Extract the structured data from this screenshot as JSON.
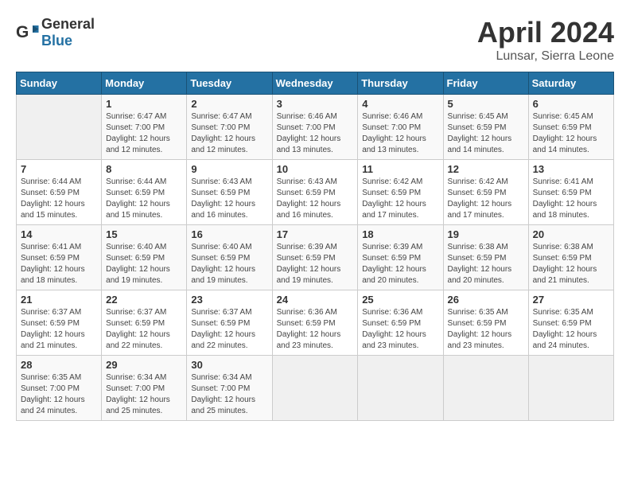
{
  "header": {
    "logo_general": "General",
    "logo_blue": "Blue",
    "month_title": "April 2024",
    "location": "Lunsar, Sierra Leone"
  },
  "days_of_week": [
    "Sunday",
    "Monday",
    "Tuesday",
    "Wednesday",
    "Thursday",
    "Friday",
    "Saturday"
  ],
  "weeks": [
    [
      {
        "day": "",
        "sunrise": "",
        "sunset": "",
        "daylight": ""
      },
      {
        "day": "1",
        "sunrise": "6:47 AM",
        "sunset": "7:00 PM",
        "daylight": "12 hours and 12 minutes."
      },
      {
        "day": "2",
        "sunrise": "6:47 AM",
        "sunset": "7:00 PM",
        "daylight": "12 hours and 12 minutes."
      },
      {
        "day": "3",
        "sunrise": "6:46 AM",
        "sunset": "7:00 PM",
        "daylight": "12 hours and 13 minutes."
      },
      {
        "day": "4",
        "sunrise": "6:46 AM",
        "sunset": "7:00 PM",
        "daylight": "12 hours and 13 minutes."
      },
      {
        "day": "5",
        "sunrise": "6:45 AM",
        "sunset": "6:59 PM",
        "daylight": "12 hours and 14 minutes."
      },
      {
        "day": "6",
        "sunrise": "6:45 AM",
        "sunset": "6:59 PM",
        "daylight": "12 hours and 14 minutes."
      }
    ],
    [
      {
        "day": "7",
        "sunrise": "6:44 AM",
        "sunset": "6:59 PM",
        "daylight": "12 hours and 15 minutes."
      },
      {
        "day": "8",
        "sunrise": "6:44 AM",
        "sunset": "6:59 PM",
        "daylight": "12 hours and 15 minutes."
      },
      {
        "day": "9",
        "sunrise": "6:43 AM",
        "sunset": "6:59 PM",
        "daylight": "12 hours and 16 minutes."
      },
      {
        "day": "10",
        "sunrise": "6:43 AM",
        "sunset": "6:59 PM",
        "daylight": "12 hours and 16 minutes."
      },
      {
        "day": "11",
        "sunrise": "6:42 AM",
        "sunset": "6:59 PM",
        "daylight": "12 hours and 17 minutes."
      },
      {
        "day": "12",
        "sunrise": "6:42 AM",
        "sunset": "6:59 PM",
        "daylight": "12 hours and 17 minutes."
      },
      {
        "day": "13",
        "sunrise": "6:41 AM",
        "sunset": "6:59 PM",
        "daylight": "12 hours and 18 minutes."
      }
    ],
    [
      {
        "day": "14",
        "sunrise": "6:41 AM",
        "sunset": "6:59 PM",
        "daylight": "12 hours and 18 minutes."
      },
      {
        "day": "15",
        "sunrise": "6:40 AM",
        "sunset": "6:59 PM",
        "daylight": "12 hours and 19 minutes."
      },
      {
        "day": "16",
        "sunrise": "6:40 AM",
        "sunset": "6:59 PM",
        "daylight": "12 hours and 19 minutes."
      },
      {
        "day": "17",
        "sunrise": "6:39 AM",
        "sunset": "6:59 PM",
        "daylight": "12 hours and 19 minutes."
      },
      {
        "day": "18",
        "sunrise": "6:39 AM",
        "sunset": "6:59 PM",
        "daylight": "12 hours and 20 minutes."
      },
      {
        "day": "19",
        "sunrise": "6:38 AM",
        "sunset": "6:59 PM",
        "daylight": "12 hours and 20 minutes."
      },
      {
        "day": "20",
        "sunrise": "6:38 AM",
        "sunset": "6:59 PM",
        "daylight": "12 hours and 21 minutes."
      }
    ],
    [
      {
        "day": "21",
        "sunrise": "6:37 AM",
        "sunset": "6:59 PM",
        "daylight": "12 hours and 21 minutes."
      },
      {
        "day": "22",
        "sunrise": "6:37 AM",
        "sunset": "6:59 PM",
        "daylight": "12 hours and 22 minutes."
      },
      {
        "day": "23",
        "sunrise": "6:37 AM",
        "sunset": "6:59 PM",
        "daylight": "12 hours and 22 minutes."
      },
      {
        "day": "24",
        "sunrise": "6:36 AM",
        "sunset": "6:59 PM",
        "daylight": "12 hours and 23 minutes."
      },
      {
        "day": "25",
        "sunrise": "6:36 AM",
        "sunset": "6:59 PM",
        "daylight": "12 hours and 23 minutes."
      },
      {
        "day": "26",
        "sunrise": "6:35 AM",
        "sunset": "6:59 PM",
        "daylight": "12 hours and 23 minutes."
      },
      {
        "day": "27",
        "sunrise": "6:35 AM",
        "sunset": "6:59 PM",
        "daylight": "12 hours and 24 minutes."
      }
    ],
    [
      {
        "day": "28",
        "sunrise": "6:35 AM",
        "sunset": "7:00 PM",
        "daylight": "12 hours and 24 minutes."
      },
      {
        "day": "29",
        "sunrise": "6:34 AM",
        "sunset": "7:00 PM",
        "daylight": "12 hours and 25 minutes."
      },
      {
        "day": "30",
        "sunrise": "6:34 AM",
        "sunset": "7:00 PM",
        "daylight": "12 hours and 25 minutes."
      },
      {
        "day": "",
        "sunrise": "",
        "sunset": "",
        "daylight": ""
      },
      {
        "day": "",
        "sunrise": "",
        "sunset": "",
        "daylight": ""
      },
      {
        "day": "",
        "sunrise": "",
        "sunset": "",
        "daylight": ""
      },
      {
        "day": "",
        "sunrise": "",
        "sunset": "",
        "daylight": ""
      }
    ]
  ]
}
